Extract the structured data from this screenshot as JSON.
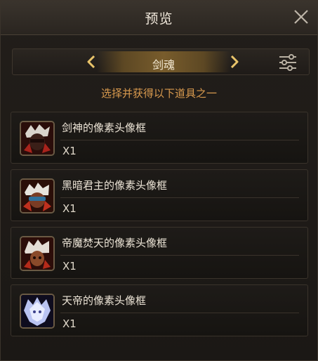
{
  "window": {
    "title": "预览"
  },
  "selector": {
    "current": "剑魂"
  },
  "subtitle": "选择并获得以下道具之一",
  "items": [
    {
      "name": "剑神的像素头像框",
      "qty": "X1"
    },
    {
      "name": "黑暗君主的像素头像框",
      "qty": "X1"
    },
    {
      "name": "帝魔焚天的像素头像框",
      "qty": "X1"
    },
    {
      "name": "天帝的像素头像框",
      "qty": "X1"
    }
  ],
  "colors": {
    "accent": "#d99a4e",
    "arrow": "#e9c46a",
    "text": "#ece4d6"
  },
  "icons": {
    "close": "close-icon",
    "prev": "chevron-left-icon",
    "next": "chevron-right-icon",
    "filter": "sliders-icon"
  }
}
